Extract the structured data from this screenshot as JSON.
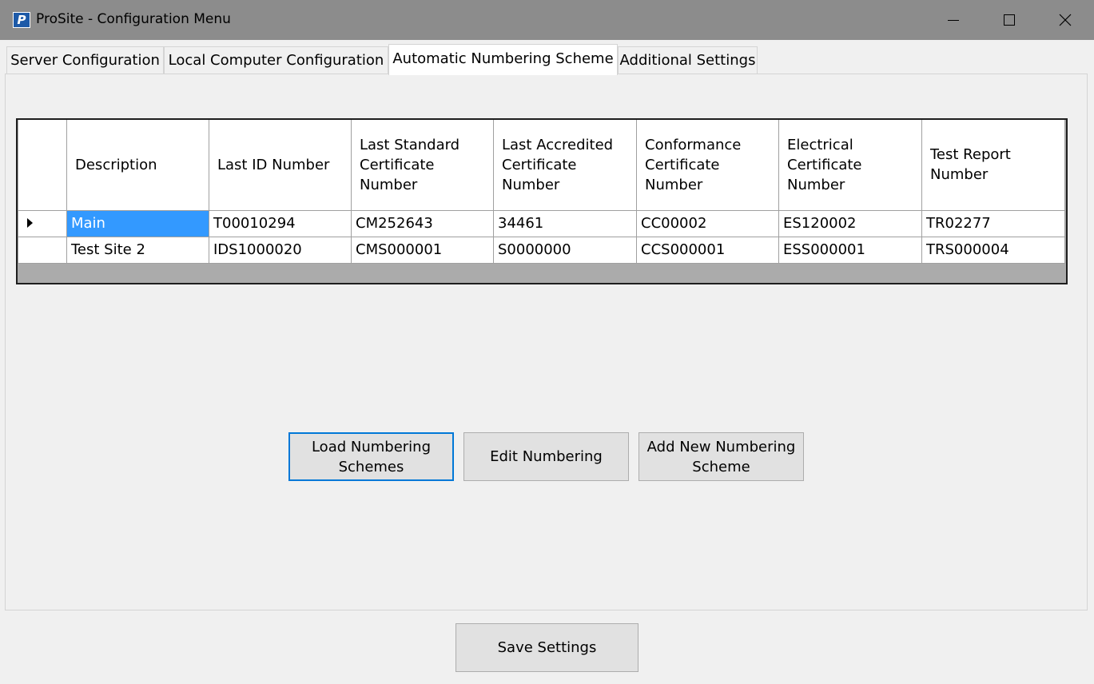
{
  "window": {
    "icon_letter": "P",
    "title": "ProSite - Configuration Menu"
  },
  "tabs": [
    {
      "label": "Server Configuration",
      "active": false
    },
    {
      "label": "Local Computer Configuration",
      "active": false
    },
    {
      "label": "Automatic Numbering Scheme",
      "active": true
    },
    {
      "label": "Additional Settings",
      "active": false
    }
  ],
  "grid": {
    "columns": [
      "Description",
      "Last ID Number",
      "Last Standard Certificate Number",
      "Last Accredited Certificate Number",
      "Conformance Certificate Number",
      "Electrical Certificate Number",
      "Test Report Number"
    ],
    "rows": [
      {
        "current": true,
        "cells": [
          "Main",
          "T00010294",
          "CM252643",
          "34461",
          "CC00002",
          "ES120002",
          "TR02277"
        ]
      },
      {
        "current": false,
        "cells": [
          "Test Site 2",
          "IDS1000020",
          "CMS000001",
          "S0000000",
          "CCS000001",
          "ESS000001",
          "TRS000004"
        ]
      }
    ],
    "selected_cell": "row 1, Description",
    "selection_color": "#3399ff"
  },
  "buttons": {
    "load": "Load Numbering Schemes",
    "edit": "Edit Numbering",
    "add": "Add New Numbering Scheme",
    "save": "Save Settings"
  },
  "colors": {
    "titlebar": "#8c8c8c",
    "focus_border": "#0078d7",
    "app_icon": "#1d5aa8"
  },
  "icons": {
    "app": "prosite-app-icon",
    "minimize": "minimize-icon",
    "maximize": "maximize-icon",
    "close": "close-icon",
    "row_indicator": "row-pointer-icon"
  }
}
